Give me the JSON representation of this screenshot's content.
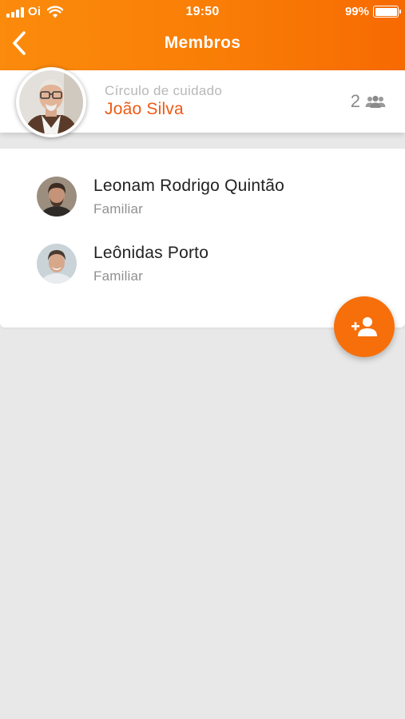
{
  "status_bar": {
    "carrier": "Oi",
    "time": "19:50",
    "battery": "99%"
  },
  "nav": {
    "title": "Membros",
    "back_icon": "chevron-left-icon"
  },
  "care_circle": {
    "caption": "Círculo de cuidado",
    "patient_name": "João Silva",
    "member_count": "2",
    "count_icon": "people-icon"
  },
  "members": [
    {
      "name": "Leonam Rodrigo Quintão",
      "role": "Familiar"
    },
    {
      "name": "Leônidas Porto",
      "role": "Familiar"
    }
  ],
  "fab": {
    "icon": "add-person-icon"
  },
  "colors": {
    "header_gradient_start": "#fb8b0c",
    "header_gradient_end": "#f76a02",
    "accent": "#ef5a12",
    "fab": "#f76f0a",
    "background": "#e8e8e8"
  }
}
